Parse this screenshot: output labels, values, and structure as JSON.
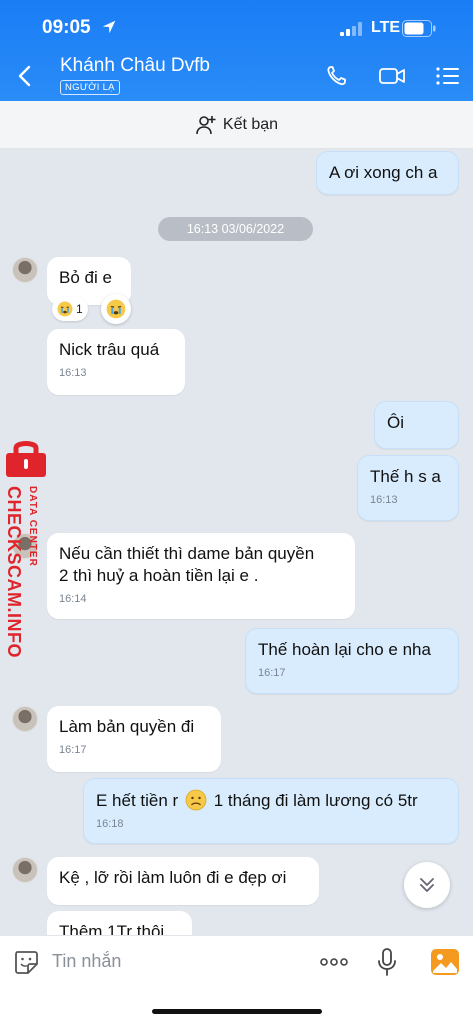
{
  "status_bar": {
    "time": "09:05",
    "network": "LTE"
  },
  "header": {
    "contact_name": "Khánh Châu Dvfb",
    "badge": "NGƯỜI LẠ"
  },
  "add_friend": {
    "label": "Kết bạn"
  },
  "chat": {
    "date_chip": "16:13 03/06/2022",
    "messages": [
      {
        "text": "A ơi xong ch a"
      },
      {
        "text": "Bỏ đi e",
        "reaction_count": "1"
      },
      {
        "text": "Nick trâu quá",
        "time": "16:13"
      },
      {
        "text": "Ôi"
      },
      {
        "text": "Thế h s a",
        "time": "16:13"
      },
      {
        "line1": "Nếu cần thiết thì dame bản quyền",
        "line2": "2 thì huỷ a hoàn tiền lại e .",
        "time": "16:14"
      },
      {
        "text": "Thế hoàn lại cho e nha",
        "time": "16:17"
      },
      {
        "text": "Làm bản quyền đi",
        "time": "16:17"
      },
      {
        "before_emoji": "E hết tiền r",
        "after_emoji": "1 tháng đi làm lương có 5tr",
        "time": "16:18"
      },
      {
        "text": "Kệ , lỡ rồi làm luôn đi e đẹp ơi"
      },
      {
        "text": "Thêm 1Tr thôi"
      }
    ]
  },
  "watermark": {
    "line1": "DATA CENTER",
    "line2": "CHECKSCAM.INFO"
  },
  "input": {
    "placeholder": "Tin nhắn"
  },
  "colors": {
    "header": "#1a7df5",
    "out_bubble": "#d8ecfd",
    "in_bubble": "#ffffff",
    "watermark": "#e0242b"
  }
}
